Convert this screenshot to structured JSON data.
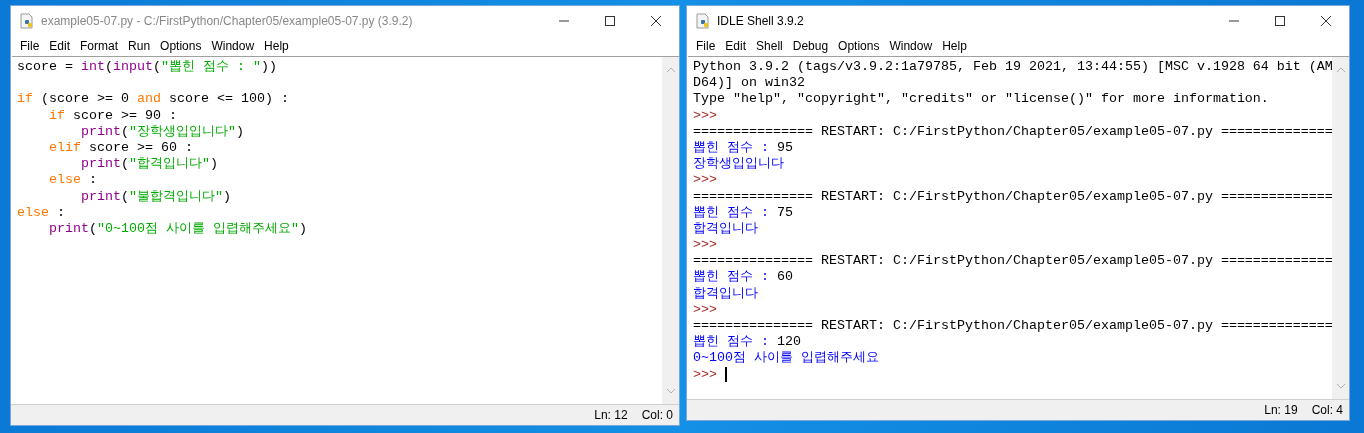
{
  "windows": [
    {
      "kind": "editor",
      "active": false,
      "title": "example05-07.py - C:/FirstPython/Chapter05/example05-07.py (3.9.2)",
      "menu": [
        "File",
        "Edit",
        "Format",
        "Run",
        "Options",
        "Window",
        "Help"
      ],
      "lines": [
        {
          "tokens": [
            {
              "kind": "plain",
              "text": "score = "
            },
            {
              "kind": "builtin",
              "text": "int"
            },
            {
              "kind": "plain",
              "text": "("
            },
            {
              "kind": "builtin",
              "text": "input"
            },
            {
              "kind": "plain",
              "text": "("
            },
            {
              "kind": "string",
              "text": "\"뽑힌 점수 : \""
            },
            {
              "kind": "plain",
              "text": "))"
            }
          ]
        },
        {
          "space_before": true,
          "tokens": [
            {
              "kind": "keyword",
              "text": "if"
            },
            {
              "kind": "plain",
              "text": " (score >= 0 "
            },
            {
              "kind": "keyword",
              "text": "and"
            },
            {
              "kind": "plain",
              "text": " score <= 100) :"
            }
          ]
        },
        {
          "tokens": [
            {
              "kind": "keyword",
              "text": "    if"
            },
            {
              "kind": "plain",
              "text": " score >= 90 :"
            }
          ]
        },
        {
          "tokens": [
            {
              "kind": "builtin",
              "text": "        print"
            },
            {
              "kind": "plain",
              "text": "("
            },
            {
              "kind": "string",
              "text": "\"장학생입입니다\""
            },
            {
              "kind": "plain",
              "text": ")"
            }
          ]
        },
        {
          "tokens": [
            {
              "kind": "keyword",
              "text": "    elif"
            },
            {
              "kind": "plain",
              "text": " score >= 60 :"
            }
          ]
        },
        {
          "tokens": [
            {
              "kind": "builtin",
              "text": "        print"
            },
            {
              "kind": "plain",
              "text": "("
            },
            {
              "kind": "string",
              "text": "\"합격입니다\""
            },
            {
              "kind": "plain",
              "text": ")"
            }
          ]
        },
        {
          "tokens": [
            {
              "kind": "keyword",
              "text": "    else"
            },
            {
              "kind": "plain",
              "text": " :"
            }
          ]
        },
        {
          "tokens": [
            {
              "kind": "builtin",
              "text": "        print"
            },
            {
              "kind": "plain",
              "text": "("
            },
            {
              "kind": "string",
              "text": "\"불합격입니다\""
            },
            {
              "kind": "plain",
              "text": ")"
            }
          ]
        },
        {
          "tokens": [
            {
              "kind": "keyword",
              "text": "else"
            },
            {
              "kind": "plain",
              "text": " :"
            }
          ]
        },
        {
          "tokens": [
            {
              "kind": "builtin",
              "text": "    print"
            },
            {
              "kind": "plain",
              "text": "("
            },
            {
              "kind": "string",
              "text": "\"0~100점 사이를 입렵해주세요\""
            },
            {
              "kind": "plain",
              "text": ")"
            }
          ]
        }
      ],
      "status": {
        "ln": "Ln: 12",
        "col": "Col: 0"
      }
    },
    {
      "kind": "shell",
      "active": true,
      "title": "IDLE Shell 3.9.2",
      "menu": [
        "File",
        "Edit",
        "Shell",
        "Debug",
        "Options",
        "Window",
        "Help"
      ],
      "lines": [
        {
          "tokens": [
            {
              "kind": "plain",
              "text": "Python 3.9.2 (tags/v3.9.2:1a79785, Feb 19 2021, 13:44:55) [MSC v.1928 64 bit (AM"
            }
          ]
        },
        {
          "tokens": [
            {
              "kind": "plain",
              "text": "D64)] on win32"
            }
          ]
        },
        {
          "tokens": [
            {
              "kind": "plain",
              "text": "Type \"help\", \"copyright\", \"credits\" or \"license()\" for more information."
            }
          ]
        },
        {
          "tokens": [
            {
              "kind": "prompt",
              "text": ">>>"
            }
          ]
        },
        {
          "tokens": [
            {
              "kind": "plain",
              "text": "=============== RESTART: C:/FirstPython/Chapter05/example05-07.py =============="
            }
          ]
        },
        {
          "tokens": [
            {
              "kind": "stdout",
              "text": "뽑힌 점수 : "
            },
            {
              "kind": "plain",
              "text": "95"
            }
          ]
        },
        {
          "tokens": [
            {
              "kind": "stdout",
              "text": "장학생입입니다"
            }
          ]
        },
        {
          "tokens": [
            {
              "kind": "prompt",
              "text": ">>>"
            }
          ]
        },
        {
          "tokens": [
            {
              "kind": "plain",
              "text": "=============== RESTART: C:/FirstPython/Chapter05/example05-07.py =============="
            }
          ]
        },
        {
          "tokens": [
            {
              "kind": "stdout",
              "text": "뽑힌 점수 : "
            },
            {
              "kind": "plain",
              "text": "75"
            }
          ]
        },
        {
          "tokens": [
            {
              "kind": "stdout",
              "text": "합격입니다"
            }
          ]
        },
        {
          "tokens": [
            {
              "kind": "prompt",
              "text": ">>>"
            }
          ]
        },
        {
          "tokens": [
            {
              "kind": "plain",
              "text": "=============== RESTART: C:/FirstPython/Chapter05/example05-07.py =============="
            }
          ]
        },
        {
          "tokens": [
            {
              "kind": "stdout",
              "text": "뽑힌 점수 : "
            },
            {
              "kind": "plain",
              "text": "60"
            }
          ]
        },
        {
          "tokens": [
            {
              "kind": "stdout",
              "text": "합격입니다"
            }
          ]
        },
        {
          "tokens": [
            {
              "kind": "prompt",
              "text": ">>>"
            }
          ]
        },
        {
          "tokens": [
            {
              "kind": "plain",
              "text": "=============== RESTART: C:/FirstPython/Chapter05/example05-07.py =============="
            }
          ]
        },
        {
          "tokens": [
            {
              "kind": "stdout",
              "text": "뽑힌 점수 : "
            },
            {
              "kind": "plain",
              "text": "120"
            }
          ]
        },
        {
          "tokens": [
            {
              "kind": "stdout",
              "text": "0~100점 사이를 입렵해주세요"
            }
          ]
        },
        {
          "cursor": true,
          "tokens": [
            {
              "kind": "prompt",
              "text": ">>>"
            }
          ]
        }
      ],
      "status": {
        "ln": "Ln: 19",
        "col": "Col: 4"
      }
    }
  ]
}
